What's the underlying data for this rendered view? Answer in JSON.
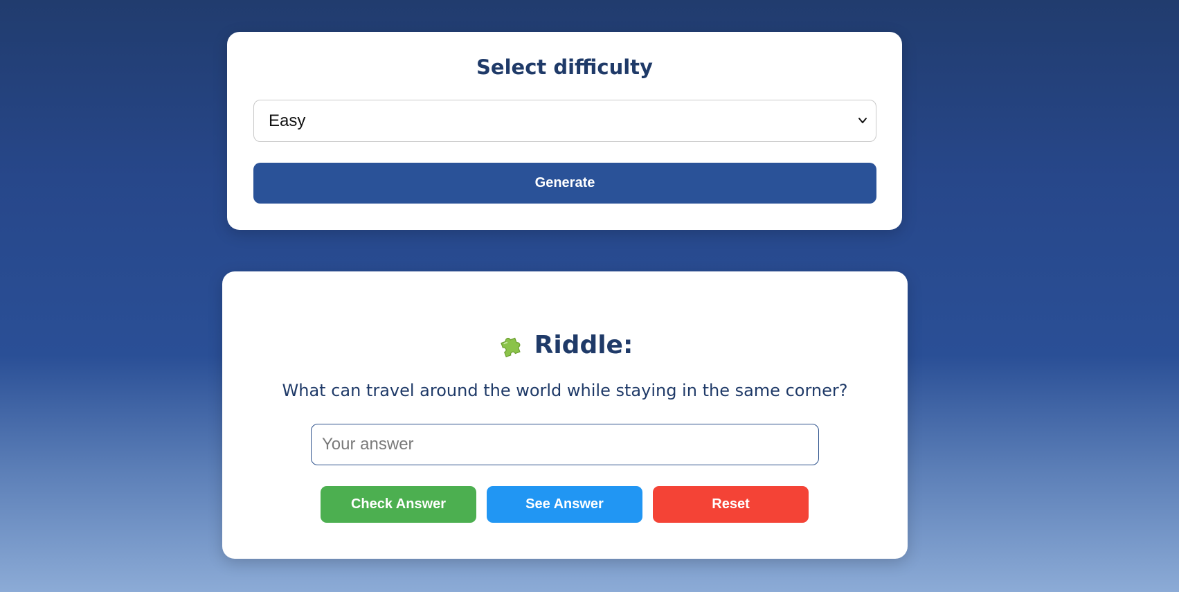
{
  "difficulty": {
    "title": "Select difficulty",
    "selected": "Easy",
    "generate_label": "Generate"
  },
  "riddle": {
    "title": "Riddle:",
    "question": "What can travel around the world while staying in the same corner?",
    "input_placeholder": "Your answer",
    "input_value": "",
    "check_label": "Check Answer",
    "see_label": "See Answer",
    "reset_label": "Reset"
  },
  "icons": {
    "title_icon": "puzzle-piece-icon",
    "select_icon": "chevron-down-icon"
  },
  "colors": {
    "title": "#1f3a68",
    "generate": "#2a5298",
    "check": "#4caf50",
    "see": "#2196f3",
    "reset": "#f44336"
  }
}
